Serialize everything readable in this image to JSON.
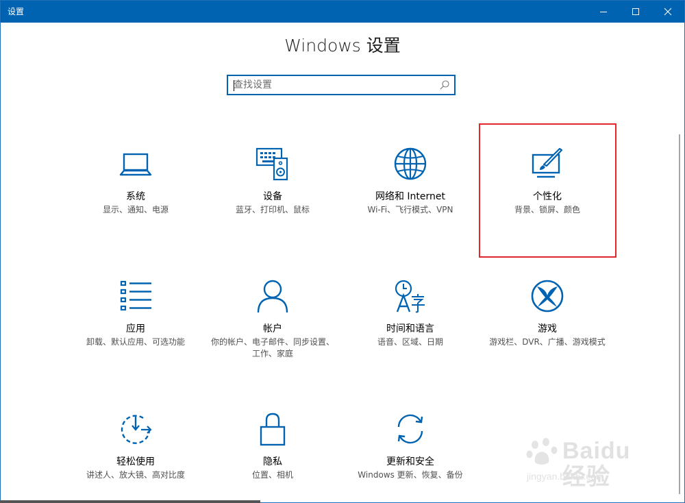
{
  "window": {
    "title": "设置",
    "controls": {
      "minimize": "minimize-icon",
      "maximize": "maximize-icon",
      "close": "close-icon"
    }
  },
  "page_title": "Windows 设置",
  "search": {
    "placeholder": "查找设置",
    "value": ""
  },
  "colors": {
    "accent": "#0063b1",
    "highlight": "#e0262b",
    "text_secondary": "#505050"
  },
  "tiles": [
    {
      "id": "system",
      "icon": "laptop-icon",
      "name": "系统",
      "desc": "显示、通知、电源"
    },
    {
      "id": "devices",
      "icon": "keyboard-speaker-icon",
      "name": "设备",
      "desc": "蓝牙、打印机、鼠标"
    },
    {
      "id": "network",
      "icon": "globe-icon",
      "name": "网络和 Internet",
      "desc": "Wi-Fi、飞行模式、VPN"
    },
    {
      "id": "personalization",
      "icon": "paint-brush-icon",
      "name": "个性化",
      "desc": "背景、锁屏、颜色",
      "highlighted": true
    },
    {
      "id": "apps",
      "icon": "list-icon",
      "name": "应用",
      "desc": "卸载、默认应用、可选功能"
    },
    {
      "id": "accounts",
      "icon": "person-icon",
      "name": "帐户",
      "desc": "你的帐户、电子邮件、同步设置、工作、家庭"
    },
    {
      "id": "time-language",
      "icon": "clock-language-icon",
      "name": "时间和语言",
      "desc": "语音、区域、日期"
    },
    {
      "id": "gaming",
      "icon": "xbox-icon",
      "name": "游戏",
      "desc": "游戏栏、DVR、广播、游戏模式"
    },
    {
      "id": "ease-of-access",
      "icon": "timer-icon",
      "name": "轻松使用",
      "desc": "讲述人、放大镜、高对比度"
    },
    {
      "id": "privacy",
      "icon": "lock-icon",
      "name": "隐私",
      "desc": "位置、相机"
    },
    {
      "id": "update-security",
      "icon": "sync-icon",
      "name": "更新和安全",
      "desc": "Windows 更新、恢复、备份"
    }
  ],
  "watermark": {
    "text": "Baidu经验",
    "url": "jingyan.baidu.com"
  }
}
